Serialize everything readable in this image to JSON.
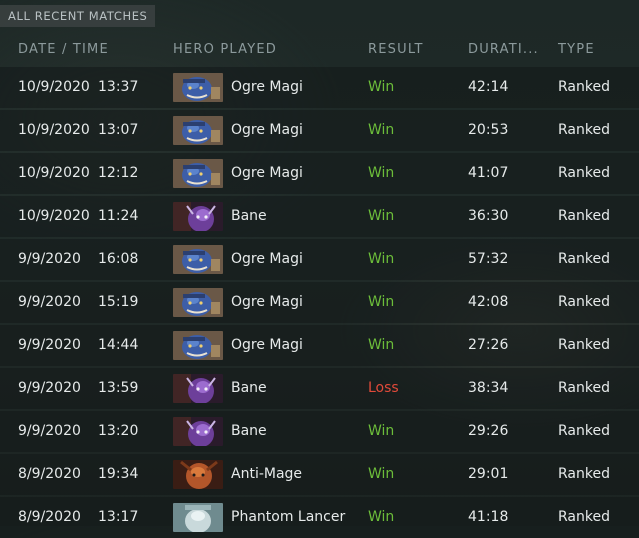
{
  "section_label": "ALL RECENT MATCHES",
  "columns": {
    "date_time": "DATE / TIME",
    "hero": "HERO PLAYED",
    "result": "RESULT",
    "duration": "DURATI...",
    "type": "TYPE"
  },
  "colors": {
    "win": "#6cbd3a",
    "loss": "#e04a3a"
  },
  "matches": [
    {
      "date": "10/9/2020",
      "time": "13:37",
      "hero": "Ogre Magi",
      "portrait_icon": "ogre-magi-portrait-icon",
      "result": "Win",
      "duration": "42:14",
      "type": "Ranked"
    },
    {
      "date": "10/9/2020",
      "time": "13:07",
      "hero": "Ogre Magi",
      "portrait_icon": "ogre-magi-portrait-icon",
      "result": "Win",
      "duration": "20:53",
      "type": "Ranked"
    },
    {
      "date": "10/9/2020",
      "time": "12:12",
      "hero": "Ogre Magi",
      "portrait_icon": "ogre-magi-portrait-icon",
      "result": "Win",
      "duration": "41:07",
      "type": "Ranked"
    },
    {
      "date": "10/9/2020",
      "time": "11:24",
      "hero": "Bane",
      "portrait_icon": "bane-portrait-icon",
      "result": "Win",
      "duration": "36:30",
      "type": "Ranked"
    },
    {
      "date": "9/9/2020",
      "time": "16:08",
      "hero": "Ogre Magi",
      "portrait_icon": "ogre-magi-portrait-icon",
      "result": "Win",
      "duration": "57:32",
      "type": "Ranked"
    },
    {
      "date": "9/9/2020",
      "time": "15:19",
      "hero": "Ogre Magi",
      "portrait_icon": "ogre-magi-portrait-icon",
      "result": "Win",
      "duration": "42:08",
      "type": "Ranked"
    },
    {
      "date": "9/9/2020",
      "time": "14:44",
      "hero": "Ogre Magi",
      "portrait_icon": "ogre-magi-portrait-icon",
      "result": "Win",
      "duration": "27:26",
      "type": "Ranked"
    },
    {
      "date": "9/9/2020",
      "time": "13:59",
      "hero": "Bane",
      "portrait_icon": "bane-portrait-icon",
      "result": "Loss",
      "duration": "38:34",
      "type": "Ranked"
    },
    {
      "date": "9/9/2020",
      "time": "13:20",
      "hero": "Bane",
      "portrait_icon": "bane-portrait-icon",
      "result": "Win",
      "duration": "29:26",
      "type": "Ranked"
    },
    {
      "date": "8/9/2020",
      "time": "19:34",
      "hero": "Anti-Mage",
      "portrait_icon": "anti-mage-portrait-icon",
      "result": "Win",
      "duration": "29:01",
      "type": "Ranked"
    },
    {
      "date": "8/9/2020",
      "time": "13:17",
      "hero": "Phantom Lancer",
      "portrait_icon": "phantom-lancer-portrait-icon",
      "result": "Win",
      "duration": "41:18",
      "type": "Ranked"
    }
  ]
}
